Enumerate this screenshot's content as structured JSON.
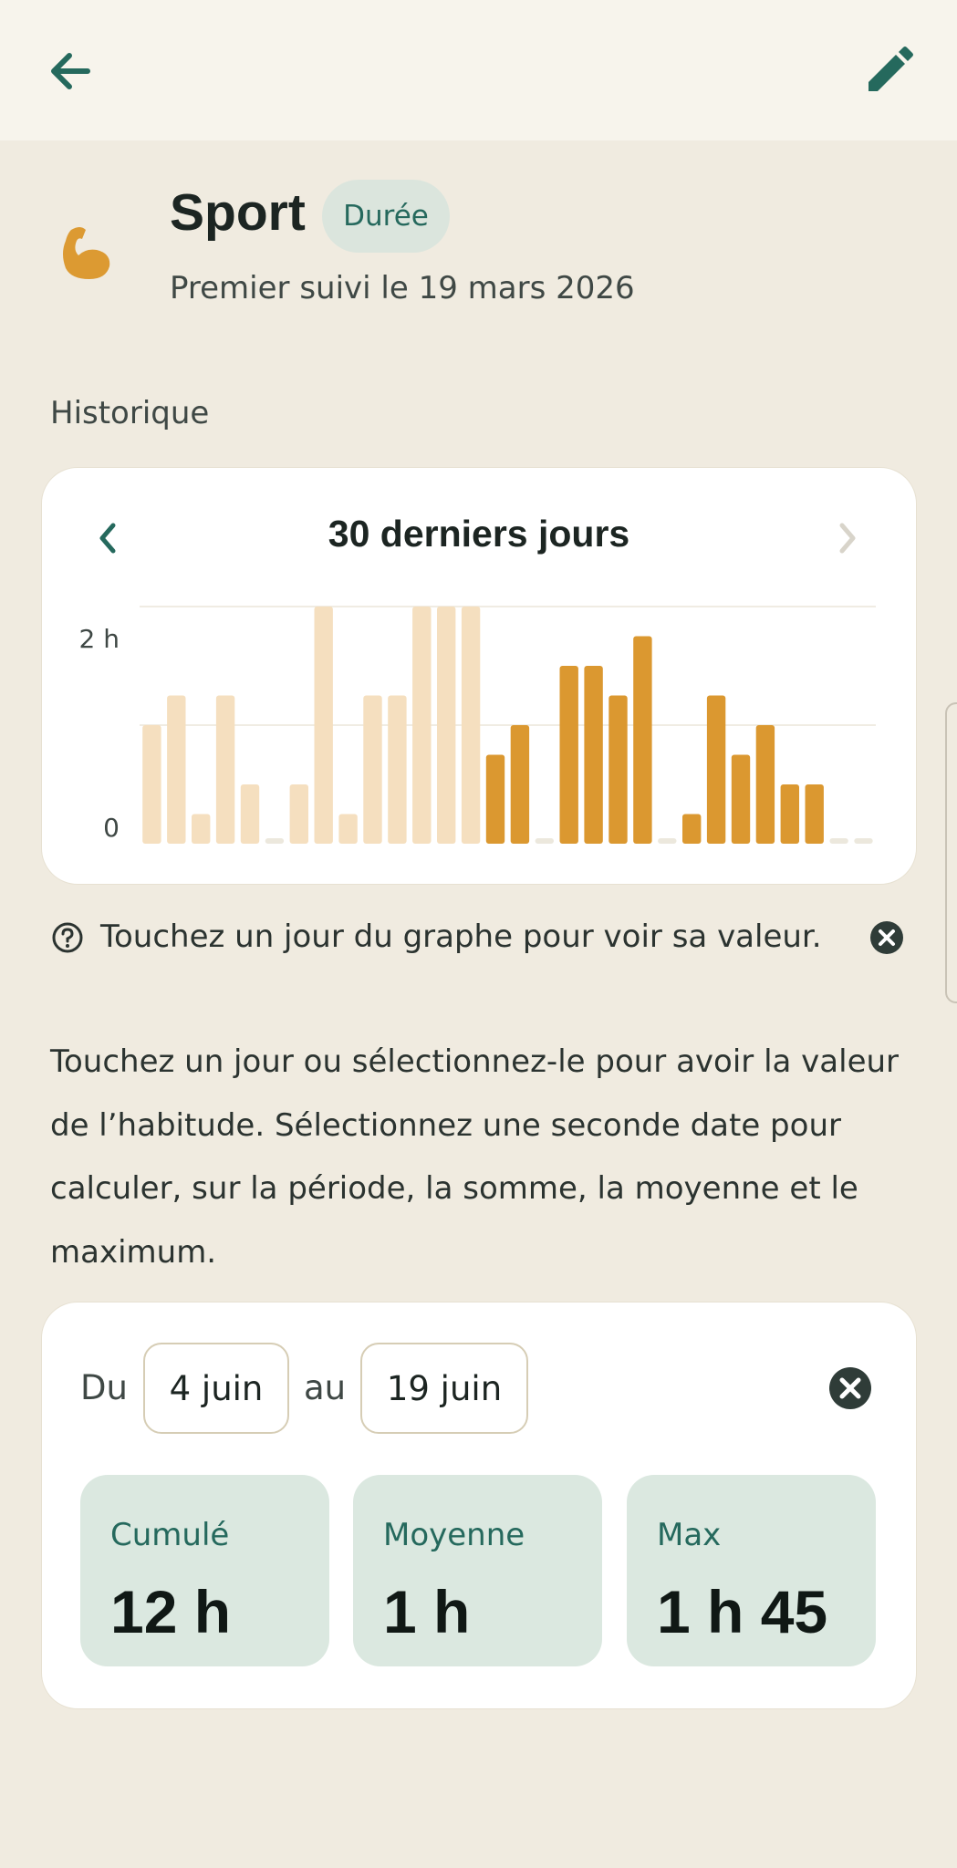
{
  "header": {
    "back_icon": "arrow-left-icon",
    "edit_icon": "pencil-icon"
  },
  "habit": {
    "icon": "flexed-biceps-icon",
    "title": "Sport",
    "type": "Durée",
    "since": "Premier suivi le 19 mars 2026"
  },
  "history": {
    "section_label": "Historique",
    "period_label": "30 derniers jours",
    "prev_icon": "chevron-left-icon",
    "next_icon": "chevron-right-icon"
  },
  "colors": {
    "accent": "#25695d",
    "bar_selected": "#db9830",
    "bar_faded": "#f5dfbf",
    "bar_zero": "#ece8dd",
    "card": "#ffffff",
    "background": "#f0ebe0",
    "stat_bg": "#dbe8e0"
  },
  "chart_data": {
    "type": "bar",
    "ylabel": "",
    "ylim": [
      0,
      2
    ],
    "y_ticks": [
      {
        "value": 0,
        "label": "0"
      },
      {
        "value": 2,
        "label": "2 h"
      }
    ],
    "gridlines": [
      1,
      2
    ],
    "selected_range": [
      14,
      29
    ],
    "values": [
      1.0,
      1.25,
      0.25,
      1.25,
      0.5,
      0,
      0.5,
      2.0,
      0.25,
      1.25,
      1.25,
      2.0,
      2.0,
      2.0,
      0.75,
      1.0,
      0,
      1.5,
      1.5,
      1.25,
      1.75,
      0,
      0.25,
      1.25,
      0.75,
      1.0,
      0.5,
      0.5,
      0,
      0
    ]
  },
  "hint": {
    "icon": "help-circle-icon",
    "text": "Touchez un jour du graphe pour voir sa valeur.",
    "close_icon": "close-circle-icon"
  },
  "description": "Touchez un jour ou sélectionnez-le pour avoir la valeur de l’habitude. Sélectionnez une seconde date pour calculer, sur la période, la somme, la moyenne et le maximum.",
  "range": {
    "from_label": "Du",
    "from_date": "4 juin",
    "to_label": "au",
    "to_date": "19 juin",
    "close_icon": "close-circle-icon",
    "stats": [
      {
        "label": "Cumulé",
        "value": "12 h"
      },
      {
        "label": "Moyenne",
        "value": "1 h"
      },
      {
        "label": "Max",
        "value": "1 h 45"
      }
    ]
  }
}
